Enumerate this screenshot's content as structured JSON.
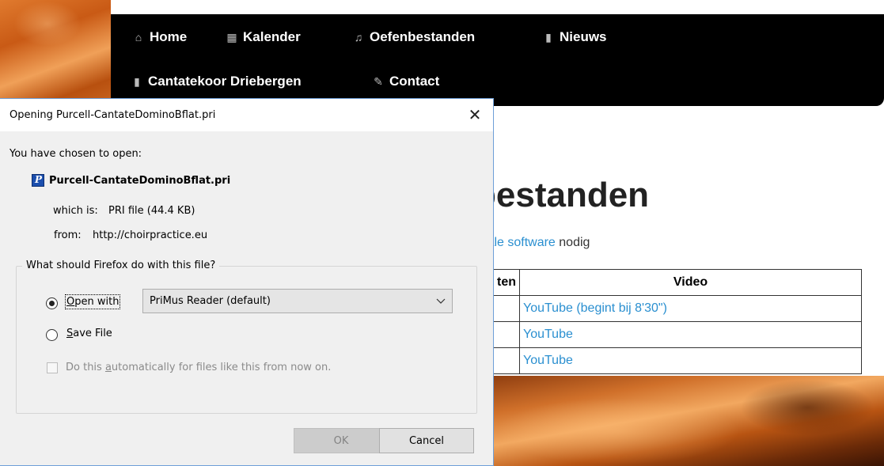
{
  "website": {
    "nav": [
      {
        "label": "Home",
        "icon": "home-icon"
      },
      {
        "label": "Kalender",
        "icon": "calendar-icon"
      },
      {
        "label": "Oefenbestanden",
        "icon": "music-note-icon"
      },
      {
        "label": "Nieuws",
        "icon": "document-icon"
      },
      {
        "label": "Cantatekoor Driebergen",
        "icon": "document-icon"
      },
      {
        "label": "Contact",
        "icon": "pencil-icon"
      }
    ],
    "heading": "bestanden",
    "intro_link": "iale software",
    "intro_rest": " nodig",
    "table": {
      "headers": [
        "ten",
        "Video"
      ],
      "rows": [
        {
          "c1": "",
          "c2": "YouTube (begint bij 8'30\")"
        },
        {
          "c1": "",
          "c2": "YouTube"
        },
        {
          "c1": "",
          "c2": "YouTube"
        }
      ]
    }
  },
  "dialog": {
    "title": "Opening Purcell-CantateDominoBflat.pri",
    "chosen_text": "You have chosen to open:",
    "file_name": "Purcell-CantateDominoBflat.pri",
    "which_is_label": "which is:",
    "which_is_value": "PRI file (44.4 KB)",
    "from_label": "from:",
    "from_value": "http://choirpractice.eu",
    "question": "What should Firefox do with this file?",
    "open_with_prefix": "",
    "open_with_underline": "O",
    "open_with_rest": "pen with",
    "app_selected": "PriMus Reader (default)",
    "save_underline": "S",
    "save_rest": "ave File",
    "auto_before": "Do this ",
    "auto_underline": "a",
    "auto_after": "utomatically for files like this from now on.",
    "ok_label": "OK",
    "cancel_label": "Cancel",
    "selected_option": "open_with",
    "auto_checked": false
  }
}
